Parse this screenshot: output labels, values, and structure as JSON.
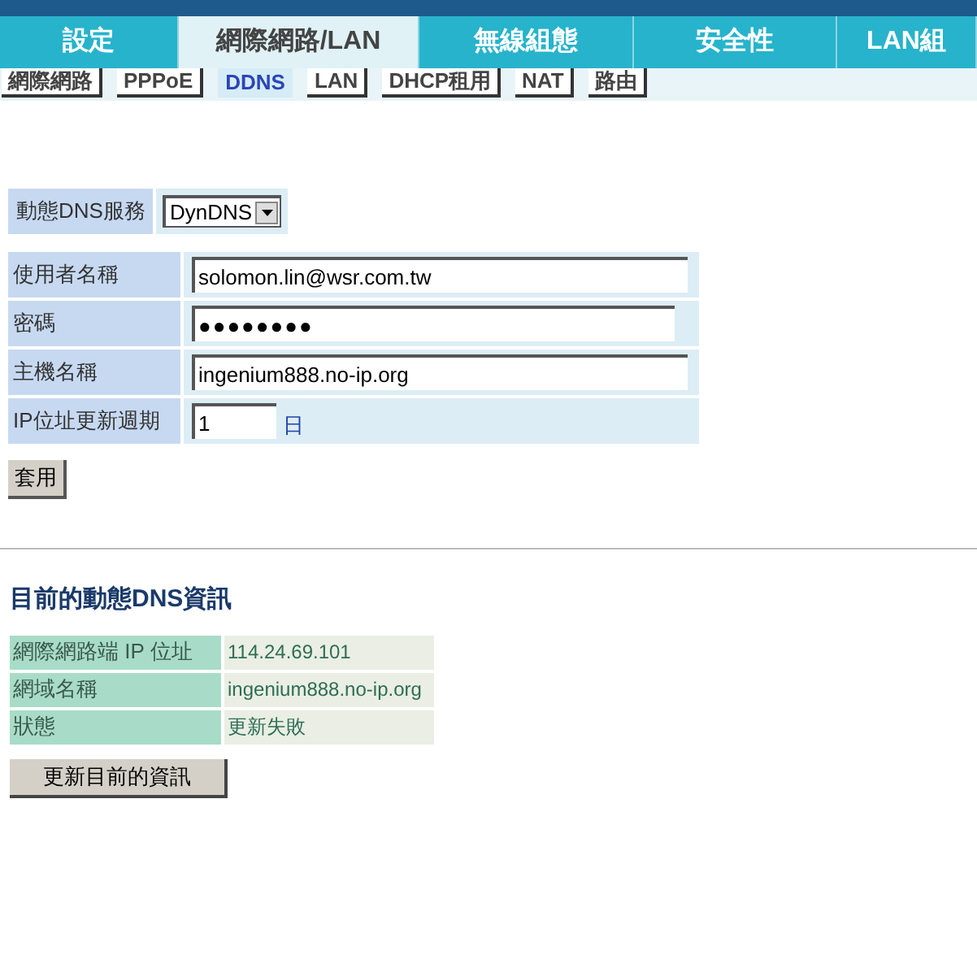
{
  "tabs": [
    {
      "label": "設定",
      "selected": false
    },
    {
      "label": "網際網路/LAN",
      "selected": true
    },
    {
      "label": "無線組態",
      "selected": false
    },
    {
      "label": "安全性",
      "selected": false
    },
    {
      "label": "LAN組",
      "selected": false
    }
  ],
  "subtabs": [
    {
      "label": "網際網路",
      "selected": false
    },
    {
      "label": "PPPoE",
      "selected": false
    },
    {
      "label": "DDNS",
      "selected": true
    },
    {
      "label": "LAN",
      "selected": false
    },
    {
      "label": "DHCP租用",
      "selected": false
    },
    {
      "label": "NAT",
      "selected": false
    },
    {
      "label": "路由",
      "selected": false
    }
  ],
  "service": {
    "label": "動態DNS服務",
    "value": "DynDNS"
  },
  "fields": [
    {
      "label": "使用者名稱",
      "value": "solomon.lin@wsr.com.tw",
      "kind": "wide"
    },
    {
      "label": "密碼",
      "value": "●●●●●●●●",
      "kind": "password"
    },
    {
      "label": "主機名稱",
      "value": "ingenium888.no-ip.org",
      "kind": "wide"
    },
    {
      "label": "IP位址更新週期",
      "value": "1",
      "unit": "日",
      "kind": "short"
    }
  ],
  "apply_button": "套用",
  "info": {
    "title": "目前的動態DNS資訊",
    "rows": [
      {
        "label": "網際網路端 IP 位址",
        "value": "114.24.69.101"
      },
      {
        "label": "網域名稱",
        "value": "ingenium888.no-ip.org"
      },
      {
        "label": "狀態",
        "value": "更新失敗"
      }
    ],
    "refresh_button": "更新目前的資訊"
  }
}
